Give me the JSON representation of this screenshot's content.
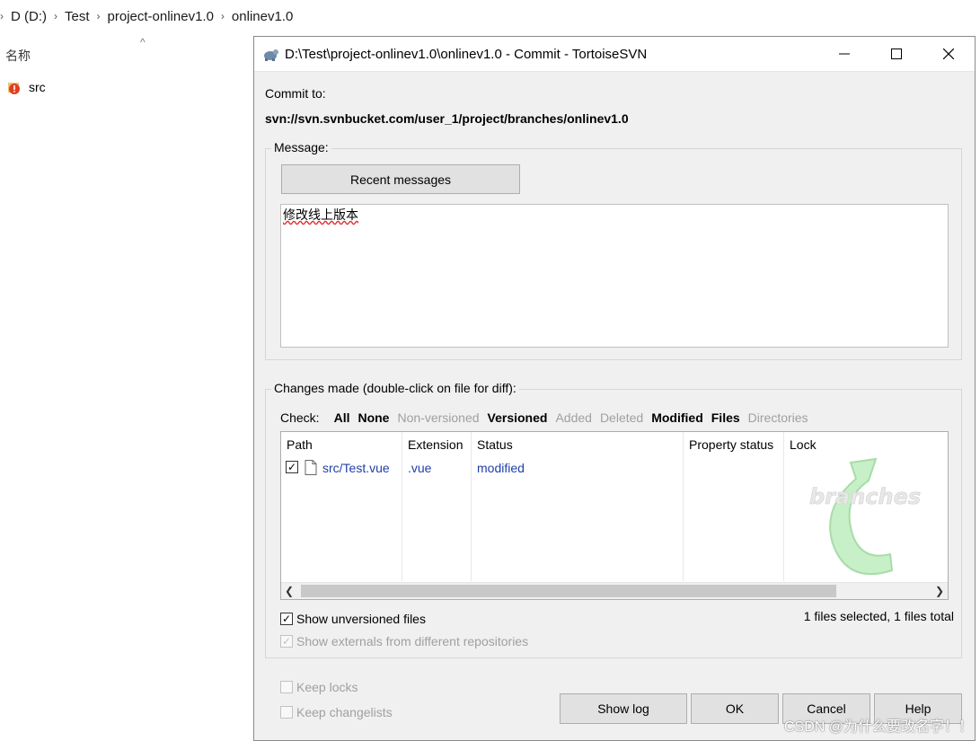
{
  "explorer": {
    "breadcrumb": [
      "D (D:)",
      "Test",
      "project-onlinev1.0",
      "onlinev1.0"
    ],
    "column_name": "名称",
    "items": [
      {
        "name": "src",
        "icon": "svn-conflict-folder-icon"
      }
    ]
  },
  "dialog": {
    "title": "D:\\Test\\project-onlinev1.0\\onlinev1.0 - Commit - TortoiseSVN",
    "commit_to_label": "Commit to:",
    "commit_to_url": "svn://svn.svnbucket.com/user_1/project/branches/onlinev1.0",
    "message_group": "Message:",
    "recent_messages": "Recent messages",
    "message_text": "修改线上版本",
    "changes_group": "Changes made (double-click on file for diff):",
    "check_label": "Check:",
    "check_items": [
      {
        "label": "All",
        "enabled": true
      },
      {
        "label": "None",
        "enabled": true
      },
      {
        "label": "Non-versioned",
        "enabled": false
      },
      {
        "label": "Versioned",
        "enabled": true
      },
      {
        "label": "Added",
        "enabled": false
      },
      {
        "label": "Deleted",
        "enabled": false
      },
      {
        "label": "Modified",
        "enabled": true
      },
      {
        "label": "Files",
        "enabled": true
      },
      {
        "label": "Directories",
        "enabled": false
      }
    ],
    "columns": [
      "Path",
      "Extension",
      "Status",
      "Property status",
      "Lock"
    ],
    "rows": [
      {
        "checked": true,
        "path": "src/Test.vue",
        "extension": ".vue",
        "status": "modified",
        "property_status": "",
        "lock": ""
      }
    ],
    "list_watermark": "branches",
    "show_unversioned": {
      "label": "Show unversioned files",
      "checked": true
    },
    "show_externals": {
      "label": "Show externals from different repositories",
      "checked": true
    },
    "selection_summary": "1 files selected, 1 files total",
    "keep_locks": {
      "label": "Keep locks",
      "checked": false
    },
    "keep_changelists": {
      "label": "Keep changelists",
      "checked": false
    },
    "buttons": {
      "show_log": "Show log",
      "ok": "OK",
      "cancel": "Cancel",
      "help": "Help"
    }
  },
  "watermark": "CSDN @为什么要改名字！！"
}
